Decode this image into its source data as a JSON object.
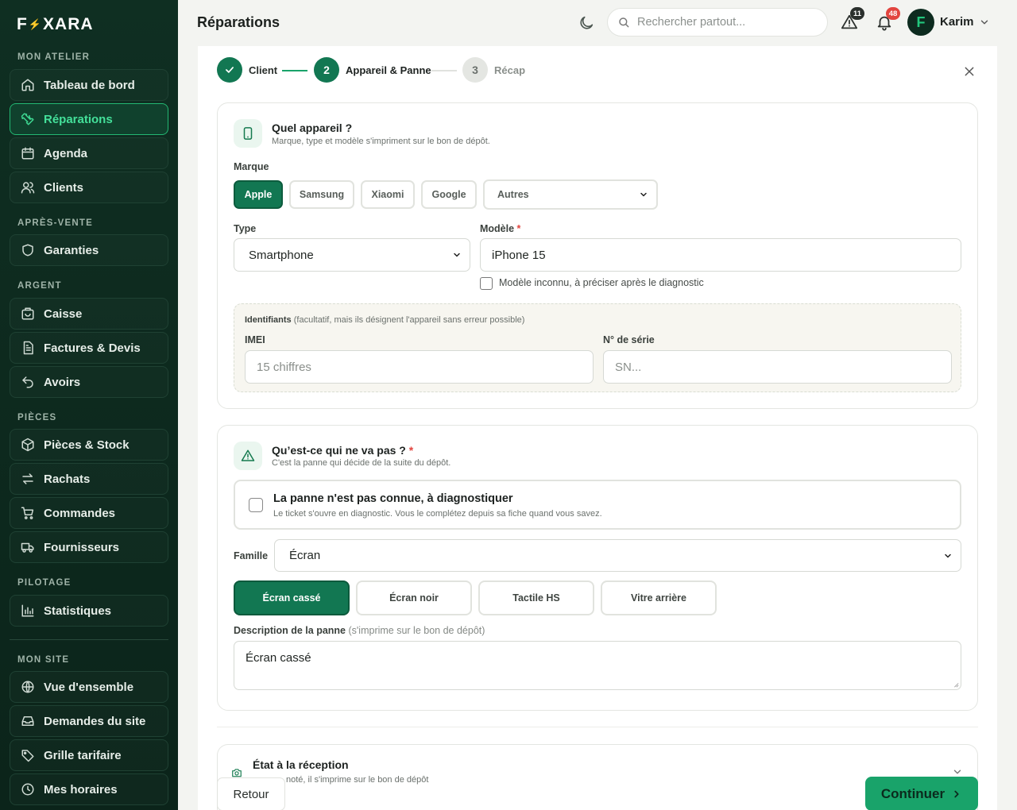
{
  "sidebar": {
    "logo_left": "F",
    "logo_bolt": "⚡",
    "logo_right": "XARA",
    "sections": [
      {
        "title": "MON ATELIER"
      },
      {
        "title": "APRÈS-VENTE"
      },
      {
        "title": "ARGENT"
      },
      {
        "title": "PIÈCES"
      },
      {
        "title": "PILOTAGE"
      },
      {
        "title": "MON SITE"
      }
    ],
    "items": [
      {
        "label": "Tableau de bord",
        "icon": "home-icon"
      },
      {
        "label": "Réparations",
        "icon": "wrench-icon",
        "active": true
      },
      {
        "label": "Agenda",
        "icon": "calendar-icon"
      },
      {
        "label": "Clients",
        "icon": "users-icon"
      },
      {
        "label": "Garanties",
        "icon": "shield-icon"
      },
      {
        "label": "Caisse",
        "icon": "cash-register-icon"
      },
      {
        "label": "Factures & Devis",
        "icon": "document-icon"
      },
      {
        "label": "Avoirs",
        "icon": "undo-icon"
      },
      {
        "label": "Pièces & Stock",
        "icon": "box-icon"
      },
      {
        "label": "Rachats",
        "icon": "exchange-icon"
      },
      {
        "label": "Commandes",
        "icon": "cart-icon"
      },
      {
        "label": "Fournisseurs",
        "icon": "truck-icon"
      },
      {
        "label": "Statistiques",
        "icon": "bar-chart-icon"
      },
      {
        "label": "Vue d'ensemble",
        "icon": "globe-icon"
      },
      {
        "label": "Demandes du site",
        "icon": "inbox-icon"
      },
      {
        "label": "Grille tarifaire",
        "icon": "tag-icon"
      },
      {
        "label": "Mes horaires",
        "icon": "clock-icon"
      }
    ]
  },
  "header": {
    "title": "Réparations",
    "search_placeholder": "Rechercher partout...",
    "alerts_count": "11",
    "notifications_count": "48",
    "avatar_initial": "F",
    "user_name": "Karim",
    "colors": {
      "accent": "#19a36a",
      "badge_dark": "#2b302d",
      "badge_red": "#e2453f"
    }
  },
  "stepper": {
    "steps": [
      {
        "number": "",
        "label": "Client",
        "state": "done"
      },
      {
        "number": "2",
        "label": "Appareil & Panne",
        "state": "current"
      },
      {
        "number": "3",
        "label": "Récap",
        "state": "upcoming"
      }
    ]
  },
  "device": {
    "title": "Quel appareil ?",
    "subtitle": "Marque, type et modèle s'impriment sur le bon de dépôt.",
    "brand_label": "Marque",
    "brands": [
      "Apple",
      "Samsung",
      "Xiaomi",
      "Google"
    ],
    "selected_brand": "Apple",
    "other_brands": "Autres",
    "type_label": "Type",
    "type_value": "Smartphone",
    "model_label": "Modèle",
    "model_required": "*",
    "model_value": "iPhone 15",
    "unknown_model_label": "Modèle inconnu, à préciser après le diagnostic",
    "identifiers_label": "Identifiants",
    "identifiers_hint": "(facultatif, mais ils désignent l'appareil sans erreur possible)",
    "imei_label": "IMEI",
    "imei_placeholder": "15 chiffres",
    "serial_label": "N° de série",
    "serial_placeholder": "SN..."
  },
  "issue": {
    "title": "Qu’est-ce qui ne va pas ?",
    "required": "*",
    "subtitle": "C'est la panne qui décide de la suite du dépôt.",
    "unknown_title": "La panne n'est pas connue, à diagnostiquer",
    "unknown_sub": "Le ticket s'ouvre en diagnostic. Vous le complétez depuis sa fiche quand vous savez.",
    "family_label": "Famille",
    "family_value": "Écran",
    "chips": [
      "Écran cassé",
      "Écran noir",
      "Tactile HS",
      "Vitre arrière"
    ],
    "selected_chip": "Écran cassé",
    "desc_label": "Description de la panne",
    "desc_hint": "(s'imprime sur le bon de dépôt)",
    "desc_value": "Écran cassé"
  },
  "reception": {
    "title": "État à la réception",
    "subtitle": "noté, il s'imprime sur le bon de dépôt"
  },
  "footer": {
    "back_label": "Retour",
    "next_label": "Continuer"
  }
}
